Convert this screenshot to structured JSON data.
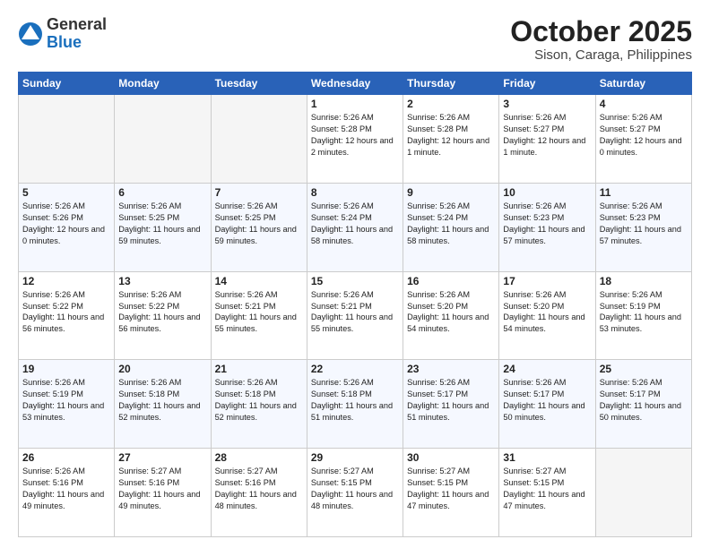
{
  "logo": {
    "general": "General",
    "blue": "Blue"
  },
  "title": "October 2025",
  "subtitle": "Sison, Caraga, Philippines",
  "days_of_week": [
    "Sunday",
    "Monday",
    "Tuesday",
    "Wednesday",
    "Thursday",
    "Friday",
    "Saturday"
  ],
  "weeks": [
    [
      {
        "day": "",
        "info": "",
        "empty": true
      },
      {
        "day": "",
        "info": "",
        "empty": true
      },
      {
        "day": "",
        "info": "",
        "empty": true
      },
      {
        "day": "1",
        "info": "Sunrise: 5:26 AM\nSunset: 5:28 PM\nDaylight: 12 hours\nand 2 minutes.",
        "empty": false
      },
      {
        "day": "2",
        "info": "Sunrise: 5:26 AM\nSunset: 5:28 PM\nDaylight: 12 hours\nand 1 minute.",
        "empty": false
      },
      {
        "day": "3",
        "info": "Sunrise: 5:26 AM\nSunset: 5:27 PM\nDaylight: 12 hours\nand 1 minute.",
        "empty": false
      },
      {
        "day": "4",
        "info": "Sunrise: 5:26 AM\nSunset: 5:27 PM\nDaylight: 12 hours\nand 0 minutes.",
        "empty": false
      }
    ],
    [
      {
        "day": "5",
        "info": "Sunrise: 5:26 AM\nSunset: 5:26 PM\nDaylight: 12 hours\nand 0 minutes.",
        "empty": false
      },
      {
        "day": "6",
        "info": "Sunrise: 5:26 AM\nSunset: 5:25 PM\nDaylight: 11 hours\nand 59 minutes.",
        "empty": false
      },
      {
        "day": "7",
        "info": "Sunrise: 5:26 AM\nSunset: 5:25 PM\nDaylight: 11 hours\nand 59 minutes.",
        "empty": false
      },
      {
        "day": "8",
        "info": "Sunrise: 5:26 AM\nSunset: 5:24 PM\nDaylight: 11 hours\nand 58 minutes.",
        "empty": false
      },
      {
        "day": "9",
        "info": "Sunrise: 5:26 AM\nSunset: 5:24 PM\nDaylight: 11 hours\nand 58 minutes.",
        "empty": false
      },
      {
        "day": "10",
        "info": "Sunrise: 5:26 AM\nSunset: 5:23 PM\nDaylight: 11 hours\nand 57 minutes.",
        "empty": false
      },
      {
        "day": "11",
        "info": "Sunrise: 5:26 AM\nSunset: 5:23 PM\nDaylight: 11 hours\nand 57 minutes.",
        "empty": false
      }
    ],
    [
      {
        "day": "12",
        "info": "Sunrise: 5:26 AM\nSunset: 5:22 PM\nDaylight: 11 hours\nand 56 minutes.",
        "empty": false
      },
      {
        "day": "13",
        "info": "Sunrise: 5:26 AM\nSunset: 5:22 PM\nDaylight: 11 hours\nand 56 minutes.",
        "empty": false
      },
      {
        "day": "14",
        "info": "Sunrise: 5:26 AM\nSunset: 5:21 PM\nDaylight: 11 hours\nand 55 minutes.",
        "empty": false
      },
      {
        "day": "15",
        "info": "Sunrise: 5:26 AM\nSunset: 5:21 PM\nDaylight: 11 hours\nand 55 minutes.",
        "empty": false
      },
      {
        "day": "16",
        "info": "Sunrise: 5:26 AM\nSunset: 5:20 PM\nDaylight: 11 hours\nand 54 minutes.",
        "empty": false
      },
      {
        "day": "17",
        "info": "Sunrise: 5:26 AM\nSunset: 5:20 PM\nDaylight: 11 hours\nand 54 minutes.",
        "empty": false
      },
      {
        "day": "18",
        "info": "Sunrise: 5:26 AM\nSunset: 5:19 PM\nDaylight: 11 hours\nand 53 minutes.",
        "empty": false
      }
    ],
    [
      {
        "day": "19",
        "info": "Sunrise: 5:26 AM\nSunset: 5:19 PM\nDaylight: 11 hours\nand 53 minutes.",
        "empty": false
      },
      {
        "day": "20",
        "info": "Sunrise: 5:26 AM\nSunset: 5:18 PM\nDaylight: 11 hours\nand 52 minutes.",
        "empty": false
      },
      {
        "day": "21",
        "info": "Sunrise: 5:26 AM\nSunset: 5:18 PM\nDaylight: 11 hours\nand 52 minutes.",
        "empty": false
      },
      {
        "day": "22",
        "info": "Sunrise: 5:26 AM\nSunset: 5:18 PM\nDaylight: 11 hours\nand 51 minutes.",
        "empty": false
      },
      {
        "day": "23",
        "info": "Sunrise: 5:26 AM\nSunset: 5:17 PM\nDaylight: 11 hours\nand 51 minutes.",
        "empty": false
      },
      {
        "day": "24",
        "info": "Sunrise: 5:26 AM\nSunset: 5:17 PM\nDaylight: 11 hours\nand 50 minutes.",
        "empty": false
      },
      {
        "day": "25",
        "info": "Sunrise: 5:26 AM\nSunset: 5:17 PM\nDaylight: 11 hours\nand 50 minutes.",
        "empty": false
      }
    ],
    [
      {
        "day": "26",
        "info": "Sunrise: 5:26 AM\nSunset: 5:16 PM\nDaylight: 11 hours\nand 49 minutes.",
        "empty": false
      },
      {
        "day": "27",
        "info": "Sunrise: 5:27 AM\nSunset: 5:16 PM\nDaylight: 11 hours\nand 49 minutes.",
        "empty": false
      },
      {
        "day": "28",
        "info": "Sunrise: 5:27 AM\nSunset: 5:16 PM\nDaylight: 11 hours\nand 48 minutes.",
        "empty": false
      },
      {
        "day": "29",
        "info": "Sunrise: 5:27 AM\nSunset: 5:15 PM\nDaylight: 11 hours\nand 48 minutes.",
        "empty": false
      },
      {
        "day": "30",
        "info": "Sunrise: 5:27 AM\nSunset: 5:15 PM\nDaylight: 11 hours\nand 47 minutes.",
        "empty": false
      },
      {
        "day": "31",
        "info": "Sunrise: 5:27 AM\nSunset: 5:15 PM\nDaylight: 11 hours\nand 47 minutes.",
        "empty": false
      },
      {
        "day": "",
        "info": "",
        "empty": true
      }
    ]
  ]
}
